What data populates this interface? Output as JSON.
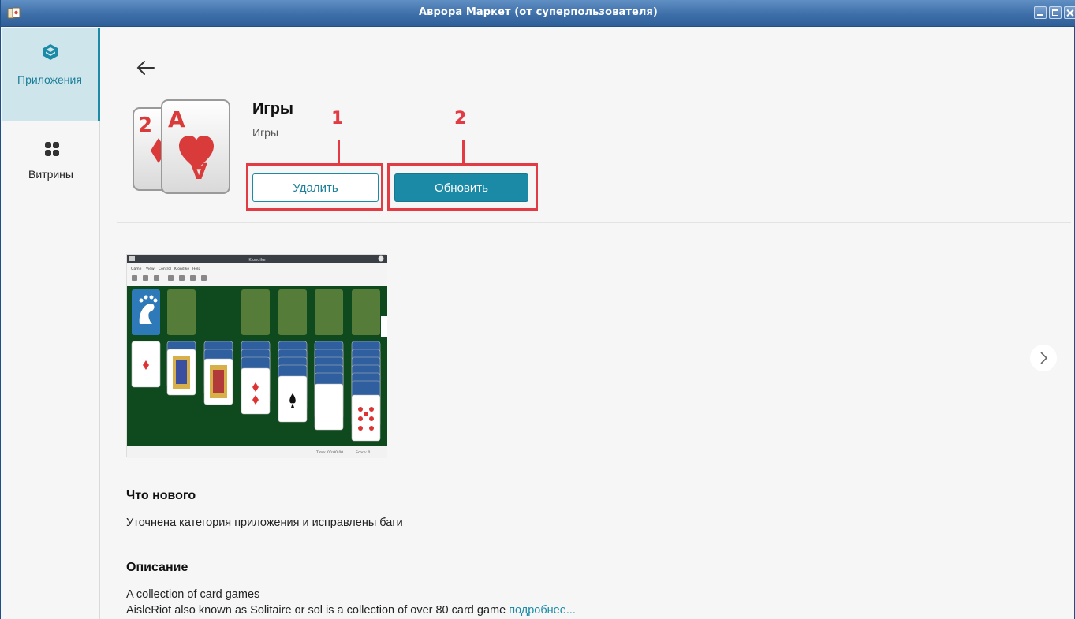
{
  "window": {
    "title": "Аврора Маркет (от суперпользователя)"
  },
  "sidebar": {
    "items": [
      {
        "label": "Приложения",
        "icon": "cube-icon",
        "active": true
      },
      {
        "label": "Витрины",
        "icon": "grid-icon",
        "active": false
      }
    ]
  },
  "app": {
    "name": "Игры",
    "category": "Игры",
    "remove_label": "Удалить",
    "update_label": "Обновить"
  },
  "annotations": {
    "label_1": "1",
    "label_2": "2"
  },
  "screenshot": {
    "window_title": "Klondike",
    "menu": [
      "Game",
      "View",
      "Control",
      "Klondike",
      "Help"
    ],
    "status_time": "Time:  00:00:00",
    "status_score": "Score:   0"
  },
  "whats_new": {
    "heading": "Что нового",
    "text": "Уточнена категория приложения и исправлены баги"
  },
  "description": {
    "heading": "Описание",
    "line1": "A collection of card games",
    "line2": "AisleRiot also known as Solitaire or sol is a collection of over 80 card game",
    "more": "подробнее..."
  },
  "colors": {
    "accent": "#1a8aa6",
    "annotation": "#e23b44",
    "titlebar": "#3e6fa8"
  }
}
